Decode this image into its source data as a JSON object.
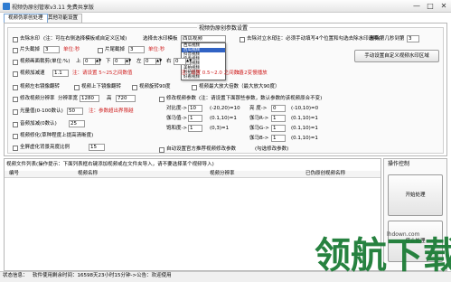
{
  "window": {
    "title": "视频伪原创管家v3.11 免费共享版",
    "min_label": "—",
    "max_label": "□",
    "close_label": "✕"
  },
  "tabs": [
    {
      "label": "视频伪原创处理"
    },
    {
      "label": "其他功能设置"
    }
  ],
  "settings": {
    "group_title": "视频伪原创参数设置",
    "options": {
      "remove_watermark": "去除水印",
      "watermark_hint": "(注：可在右侧选择模板或自定义区域)",
      "template_label": "选择去水印模板",
      "template_selected": "西瓜视频",
      "template_options": [
        "西瓜视频",
        "西瓜视频",
        "抖音视频",
        "快手视频",
        "微视视频",
        "美拍视频",
        "秒拍视频",
        "好看视频"
      ],
      "watermark_mode_hint": "去水印方式（勾选后自动选择去水印区域）",
      "right_watermark": "去除对立水印",
      "right_watermark_hint": "(注：必须手动填写4个位置和勾选去除水印选项)",
      "delete_frame_label": "删除第几秒到第",
      "delete_frame_value": "3",
      "head_clip": "片头截掉",
      "head_clip_value": "3",
      "head_unit": "单位:秒",
      "tail_clip": "片尾截掉",
      "tail_clip_value": "3",
      "tail_unit": "单位:秒",
      "custom_region_button": "手动设置自定义视频水印区域",
      "crop_frame": "视频画面裁剪(单位:%)",
      "top_label": "上",
      "top_value": "0",
      "bottom_label": "下",
      "bottom_value": "0",
      "left_label": "左",
      "left_value": "0",
      "right_label": "右",
      "right_value": "0",
      "crop_note": "注：请设置 5~25之间数值",
      "crop_note2": "注：5~25之间数值",
      "speed_change": "视频加减速",
      "speed_value": "1.1",
      "speed_note": "注：设置 0.5~2.0 之间数值",
      "speed_note2": "1~2变慢播放",
      "flip_h": "视频左右镜像翻转",
      "flip_v": "视频上下镜像翻转",
      "rotate_90": "视频旋转90度",
      "scale_max": "视频最大放大倍数（最大放大90度）",
      "modify_res": "修改视频分辨率",
      "res_label": "分辨率宽",
      "res_width": "1280",
      "res_height_label": "高",
      "res_height": "720",
      "modify_params": "修改视频参数",
      "params_note": "(注：请设置下面那些参数，数认参数的该视频原合不变)",
      "brightness": "光量值(0-100数认)",
      "brightness_value": "50",
      "brightness_note": "注：参数超出界限越",
      "contrast_label": "对比度->",
      "contrast_value": "10",
      "contrast_range": "(-20,20)=10",
      "bright_label": "亮 度->",
      "bright_value": "0",
      "bright_range": "(-10,10)=0",
      "gamma_label": "伽马值->",
      "gamma_value": "1",
      "gamma_range": "(0.1,10)=1",
      "r_label": "伽马R->",
      "r_value": "1",
      "r_range": "(0.1,10)=1",
      "saturation_label": "饱和度->",
      "saturation_value": "1",
      "saturation_range": "(0,3)=1",
      "g_label": "伽马G->",
      "g_value": "1",
      "g_range": "(0.1,10)=1",
      "audio_change": "音频加减(0数认)",
      "audio_value": "25",
      "sharpen": "视频锐化(数认不超过)",
      "b_label": "伽马B->",
      "b_value": "1",
      "b_range": "(0.1,10)=1",
      "auto_settings": "自动设置官方推荐视频修改参数",
      "auto_settings_hint": "(勾选修改参数)",
      "bg_blur": "视频修化(草种程度上提高清晰度)",
      "full_screen": "全屏虚化背景亮度比例",
      "full_screen_value": "15"
    }
  },
  "list": {
    "title": "视频文件列表(操作提示：下面列表框右键添加视频或在文件夹导入，请不要选择某个视频导入)",
    "headers": [
      "编号",
      "视频名称",
      "视频分辨率",
      "已伪原创视频名称"
    ]
  },
  "operation": {
    "title": "操作控制",
    "start_button": "开始处理",
    "stop_button": "停止处理"
  },
  "status": {
    "label": "状态信息：",
    "message": "软件使用剩余时间：16598天23小时15分钟->公告：欢迎使用"
  },
  "brand": {
    "text": "领航下载",
    "url_text": "lhdown.com"
  }
}
